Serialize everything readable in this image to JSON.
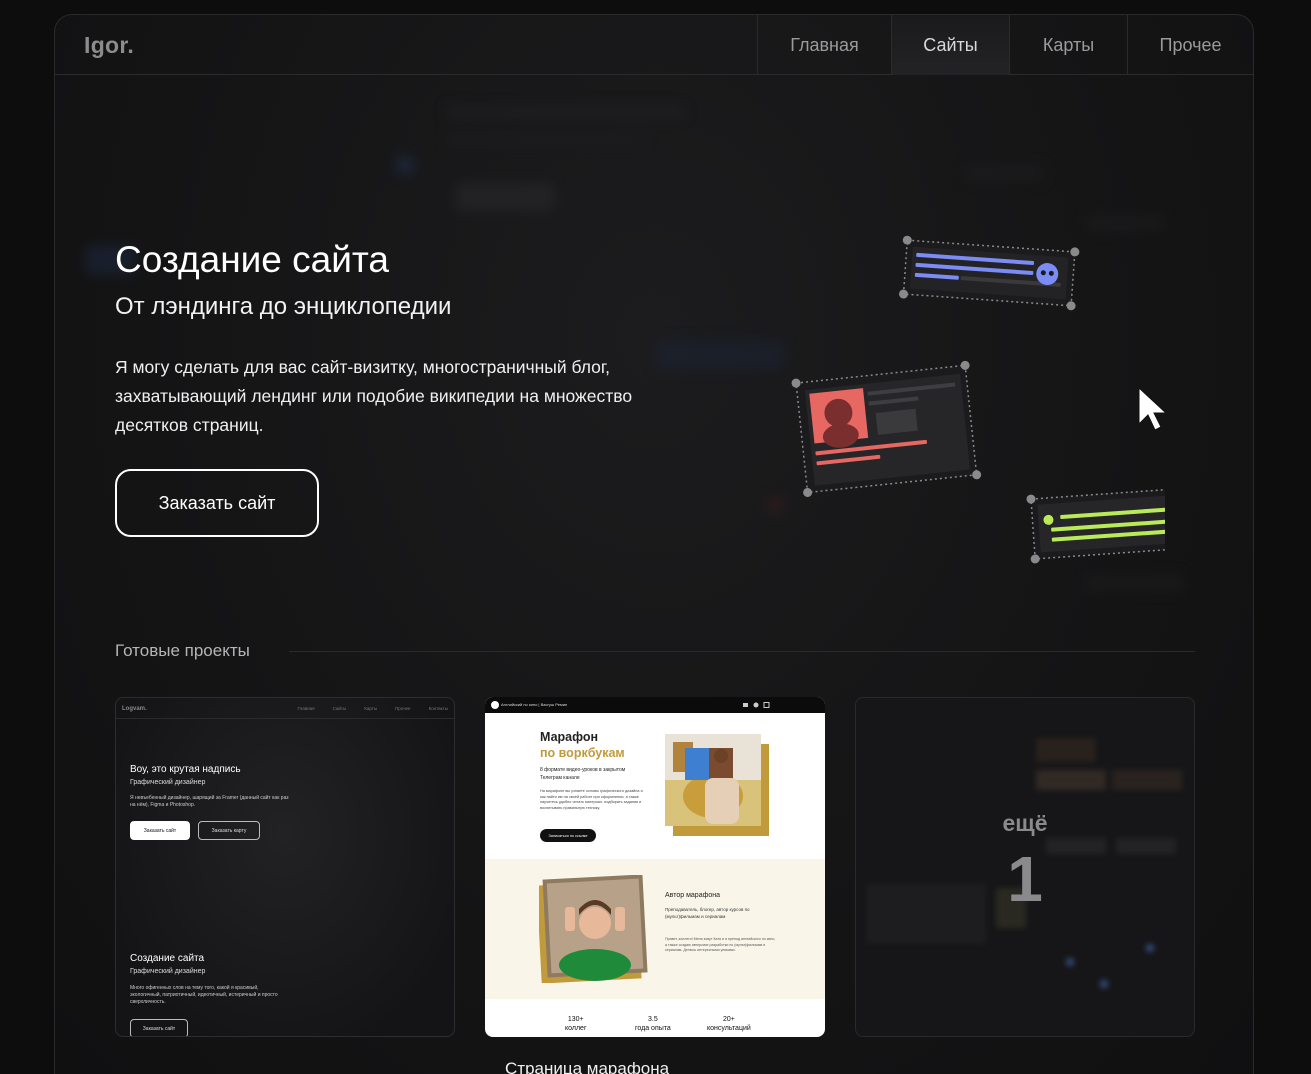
{
  "header": {
    "logo": "Igor.",
    "nav": [
      {
        "label": "Главная"
      },
      {
        "label": "Сайты"
      },
      {
        "label": "Карты"
      },
      {
        "label": "Прочее"
      }
    ]
  },
  "hero": {
    "title": "Создание сайта",
    "subtitle": "От лэндинга до энциклопедии",
    "text": "Я могу сделать для вас сайт-визитку, многостраничный блог, захватывающий лендинг или подобие википедии на множество десятков страниц.",
    "button": "Заказать сайт"
  },
  "projects": {
    "title": "Готовые проекты",
    "card1": {
      "logo": "Logvam.",
      "nav": [
        "Главная",
        "Сайты",
        "Карты",
        "Прочее",
        "Контакты"
      ],
      "heading": "Воу, это крутая надпись",
      "subheading": "Графический дизайнер",
      "text": "Я невъебенный дизайнер, шарящий за Framer (данный сайт как раз на нём), Figma и Photoshop.",
      "button1": "Заказать сайт",
      "button2": "Заказать карту",
      "heading2": "Создание сайта",
      "subheading2": "Графический дизайнер",
      "text2": "Много офигенных слов на тему того, какой я красивый, экологичный, патриотичный, идеотичный, истеричный и просто сверхличность.",
      "button3": "Заказать сайт"
    },
    "card2": {
      "topbar": "Английский по кино | Васгуш Ремин",
      "title1": "Марафон",
      "title2": "по воркбукам",
      "subtitle": "8 формате видео-уроков в закрытом Телеграм канале",
      "text": "На марафоне вы узнаете основы графического дизайна и как найти им на своей работе при оформлении, а также научитесь удобно читать материал, подбирать задания и воспитывать правильную технику.",
      "button": "Записаться по ссылке",
      "author_title": "Автор марафона",
      "author_sub": "Преподаватель, блогер, автор курсов по (мульт)фильмам и сериалам",
      "author_text": "Привет, коллеги! Меня зовут Катя и я препод английского по кино, а также создаю авторские разработки по (мульт)фильмам и сериалам. Делюсь интересными уликами.",
      "stats": [
        {
          "value": "130+",
          "label": "коллег"
        },
        {
          "value": "3.5",
          "label": "года опыта"
        },
        {
          "value": "20+",
          "label": "консультаций"
        }
      ],
      "caption": "Страница марафона"
    },
    "card3": {
      "more_label": "ещё",
      "more_count": "1"
    }
  },
  "colors": {
    "accent_blue": "#7b8cf5",
    "accent_red": "#e76763",
    "accent_green": "#b8ea5a",
    "gold": "#c19a3b"
  }
}
